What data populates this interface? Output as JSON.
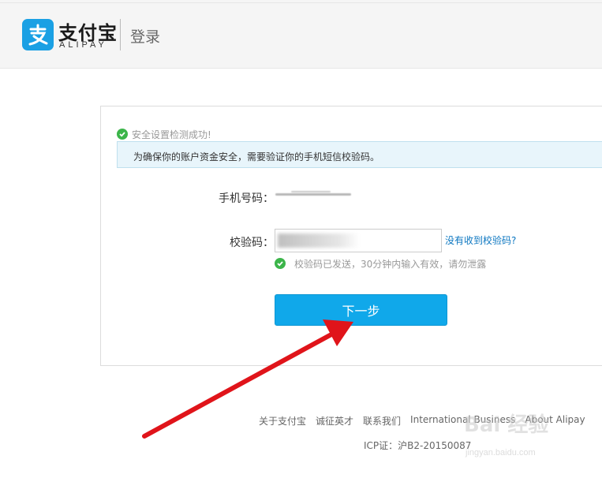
{
  "header": {
    "logo_cn": "支付宝",
    "logo_en": "ALIPAY",
    "title": "登录"
  },
  "status": {
    "success_text": "安全设置检测成功!",
    "banner_text": "为确保你的账户资金安全，需要验证你的手机短信校验码。"
  },
  "form": {
    "phone_label": "手机号码：",
    "code_label": "校验码：",
    "code_value": "",
    "resend_link": "没有收到校验码?",
    "hint_text": "校验码已发送，30分钟内输入有效，请勿泄露",
    "next_button": "下一步"
  },
  "footer": {
    "links": [
      "关于支付宝",
      "诚征英才",
      "联系我们",
      "International Business",
      "About Alipay"
    ],
    "icp": "ICP证：沪B2-20150087"
  },
  "watermark": {
    "brand": "Bai 经验",
    "site": "jingyan.baidu.com"
  },
  "colors": {
    "brand_blue": "#1aa0e4",
    "button_blue": "#10a8ea",
    "success_green": "#3cb54a",
    "link_blue": "#0b76c0",
    "annotation_red": "#e0141a"
  }
}
